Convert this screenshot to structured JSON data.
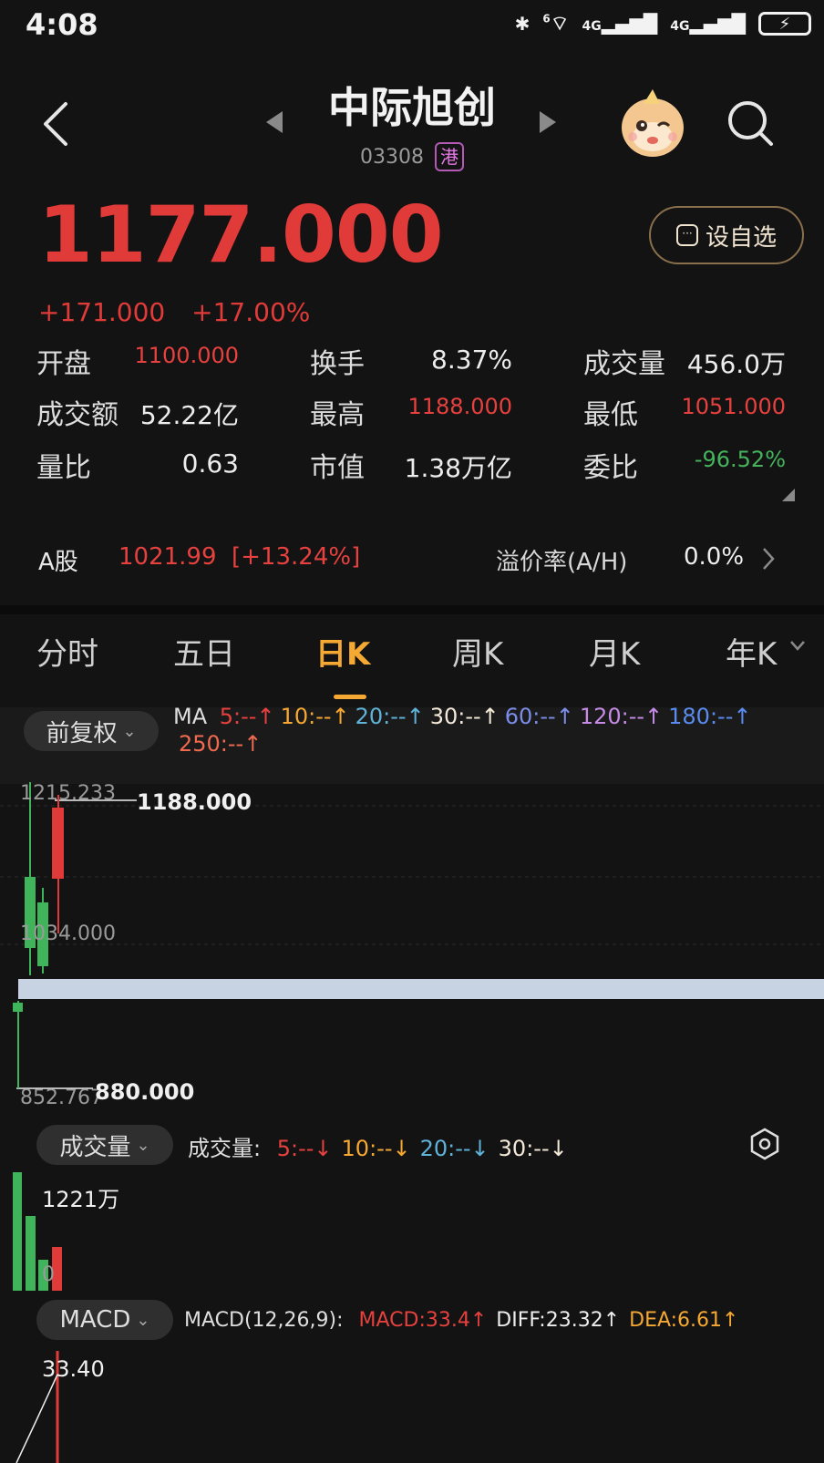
{
  "status_bar": {
    "time": "4:08",
    "network": "4G",
    "network2": "4G",
    "wifi_badge": "6"
  },
  "header": {
    "title": "中际旭创",
    "code": "03308",
    "market_badge": "港"
  },
  "quote": {
    "price": "1177.000",
    "change": "+171.000",
    "change_pct": "+17.00%",
    "add_watchlist": "设自选"
  },
  "stats": [
    {
      "label": "开盘",
      "value": "1100.000",
      "color": "#e6413e"
    },
    {
      "label": "换手",
      "value": "8.37%",
      "color": "#ededed"
    },
    {
      "label": "成交量",
      "value": "456.0万",
      "color": "#ededed"
    },
    {
      "label": "成交额",
      "value": "52.22亿",
      "color": "#ededed"
    },
    {
      "label": "最高",
      "value": "1188.000",
      "color": "#e6413e"
    },
    {
      "label": "最低",
      "value": "1051.000",
      "color": "#e6413e"
    },
    {
      "label": "量比",
      "value": "0.63",
      "color": "#ededed"
    },
    {
      "label": "市值",
      "value": "1.38万亿",
      "color": "#ededed"
    },
    {
      "label": "委比",
      "value": "-96.52%",
      "color": "#44b35c"
    }
  ],
  "a_share": {
    "label": "A股",
    "price": "1021.99",
    "change": "[+13.24%]",
    "premium_label": "溢价率(A/H)",
    "premium_value": "0.0%"
  },
  "tabs": [
    "分时",
    "五日",
    "日K",
    "周K",
    "月K",
    "年K"
  ],
  "active_tab": "日K",
  "kline": {
    "adjust_label": "前复权",
    "ma_prefix": "MA",
    "ma_items": [
      {
        "text": "5:--↑",
        "color": "#e6413e"
      },
      {
        "text": "10:--↑",
        "color": "#f5a832"
      },
      {
        "text": "20:--↑",
        "color": "#5fb3d9"
      },
      {
        "text": "30:--↑",
        "color": "#f4e9d8"
      },
      {
        "text": "60:--↑",
        "color": "#7b8de8"
      },
      {
        "text": "120:--↑",
        "color": "#c58be6"
      },
      {
        "text": "180:--↑",
        "color": "#5a8cf0"
      },
      {
        "text": "250:--↑",
        "color": "#f06a50"
      }
    ],
    "axis_top": "1215.233",
    "axis_mid": "1034.000",
    "axis_bottom": "852.767",
    "high_marker": "1188.000",
    "low_marker": "880.000"
  },
  "volume": {
    "selector": "成交量",
    "label": "成交量:",
    "items": [
      {
        "text": "5:--↓",
        "color": "#e6413e"
      },
      {
        "text": "10:--↓",
        "color": "#f5a832"
      },
      {
        "text": "20:--↓",
        "color": "#5fb3d9"
      },
      {
        "text": "30:--↓",
        "color": "#f4e9d8"
      }
    ],
    "max": "1221万",
    "zero": "0"
  },
  "macd": {
    "selector": "MACD",
    "label": "MACD(12,26,9):",
    "items": [
      {
        "text": "MACD:33.4↑",
        "color": "#e6413e"
      },
      {
        "text": "DIFF:23.32↑",
        "color": "#ededed"
      },
      {
        "text": "DEA:6.61↑",
        "color": "#f5a832"
      }
    ],
    "axis_top": "33.40"
  }
}
